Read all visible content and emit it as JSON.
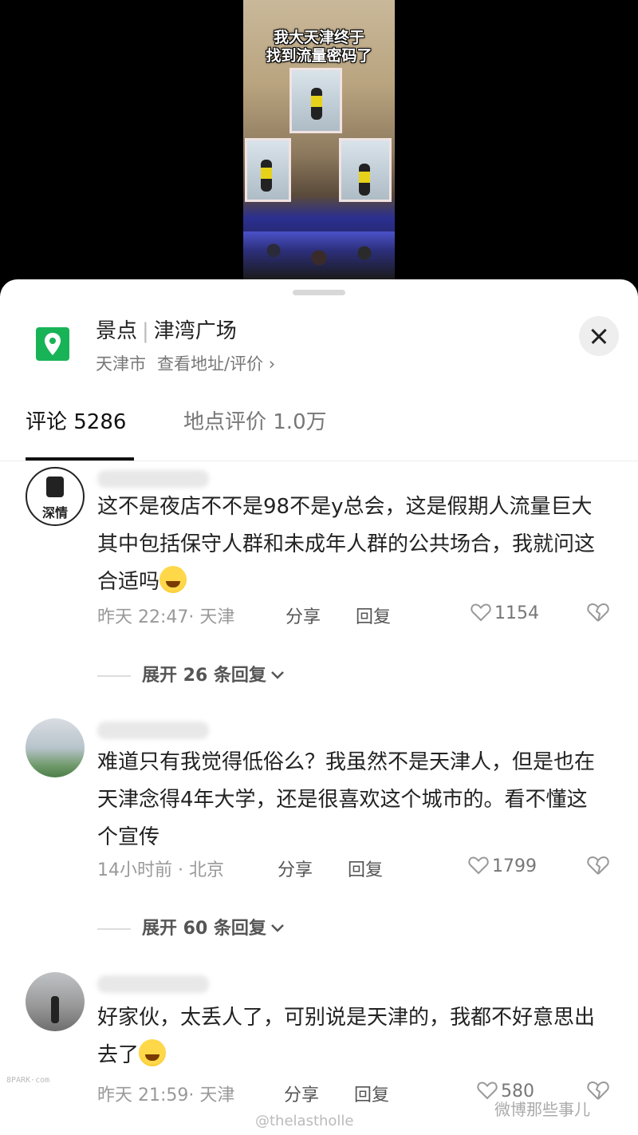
{
  "video": {
    "caption_line1": "我大天津终于",
    "caption_line2": "找到流量密码了"
  },
  "location": {
    "category": "景点",
    "name": "津湾广场",
    "city": "天津市",
    "link": "查看地址/评价 ›",
    "icon": "location-pin-icon",
    "accent": "#19b357"
  },
  "tabs": [
    {
      "label": "评论 5286",
      "active": true
    },
    {
      "label": "地点评价 1.0万",
      "active": false
    }
  ],
  "comments": [
    {
      "avatar_text": "深情",
      "text": "这不是夜店不不是98不是y总会，这是假期人流量巨大其中包括保守人群和未成年人群的公共场合，我就问这合适吗",
      "emoji": "sweat-smile-emoji",
      "time": "昨天 22:47· 天津",
      "share": "分享",
      "reply": "回复",
      "likes": "1154",
      "expand": "展开 26 条回复"
    },
    {
      "avatar_text": "",
      "text": "难道只有我觉得低俗么？我虽然不是天津人，但是也在天津念得4年大学，还是很喜欢这个城市的。看不懂这个宣传",
      "time": "14小时前 · 北京",
      "share": "分享",
      "reply": "回复",
      "likes": "1799",
      "expand": "展开 60 条回复"
    },
    {
      "avatar_text": "",
      "text": "好家伙，太丢人了，可别说是天津的，我都不好意思出去了",
      "emoji": "rofl-emoji",
      "time": "昨天 21:59· 天津",
      "share": "分享",
      "reply": "回复",
      "likes": "580"
    }
  ],
  "watermarks": {
    "left": "8PARK·com",
    "bottom_right": "微博那些事儿",
    "bottom": "@thelastholle"
  }
}
